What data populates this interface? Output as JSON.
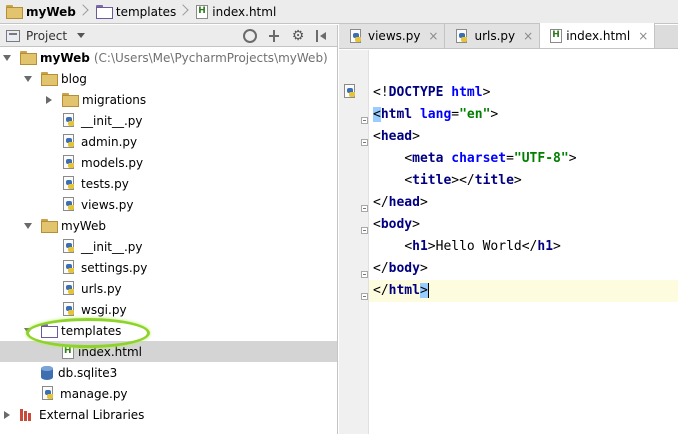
{
  "breadcrumb": {
    "items": [
      "myWeb",
      "templates",
      "index.html"
    ]
  },
  "project_panel": {
    "title": "Project",
    "tree": [
      {
        "label": "myWeb",
        "path": "(C:\\Users\\Me\\PycharmProjects\\myWeb)",
        "kind": "folder",
        "depth": 0,
        "expanded": true
      },
      {
        "label": "blog",
        "kind": "package",
        "depth": 1,
        "expanded": true
      },
      {
        "label": "migrations",
        "kind": "package",
        "depth": 2,
        "expanded": false
      },
      {
        "label": "__init__.py",
        "kind": "py",
        "depth": 2
      },
      {
        "label": "admin.py",
        "kind": "py",
        "depth": 2
      },
      {
        "label": "models.py",
        "kind": "py",
        "depth": 2
      },
      {
        "label": "tests.py",
        "kind": "py",
        "depth": 2
      },
      {
        "label": "views.py",
        "kind": "py",
        "depth": 2
      },
      {
        "label": "myWeb",
        "kind": "package",
        "depth": 1,
        "expanded": true
      },
      {
        "label": "__init__.py",
        "kind": "py",
        "depth": 2
      },
      {
        "label": "settings.py",
        "kind": "py",
        "depth": 2
      },
      {
        "label": "urls.py",
        "kind": "py",
        "depth": 2
      },
      {
        "label": "wsgi.py",
        "kind": "py",
        "depth": 2
      },
      {
        "label": "templates",
        "kind": "template-folder",
        "depth": 1,
        "expanded": true
      },
      {
        "label": "index.html",
        "kind": "html",
        "depth": 2,
        "selected": true
      },
      {
        "label": "db.sqlite3",
        "kind": "db",
        "depth": 1
      },
      {
        "label": "manage.py",
        "kind": "py",
        "depth": 1
      },
      {
        "label": "External Libraries",
        "kind": "lib",
        "depth": 0,
        "expanded": false
      }
    ]
  },
  "editor": {
    "tabs": [
      {
        "label": "views.py",
        "close": "×",
        "active": false
      },
      {
        "label": "urls.py",
        "close": "×",
        "active": false
      },
      {
        "label": "index.html",
        "close": "×",
        "active": true
      }
    ],
    "lines": [
      [
        [
          "punct",
          "<!"
        ],
        [
          "tag",
          "DOCTYPE "
        ],
        [
          "attr",
          "html"
        ],
        [
          "punct",
          ">"
        ]
      ],
      [
        [
          "match",
          "<"
        ],
        [
          "tag",
          "html "
        ],
        [
          "attr",
          "lang"
        ],
        [
          "punct",
          "="
        ],
        [
          "str",
          "\"en\""
        ],
        [
          "punct",
          ">"
        ]
      ],
      [
        [
          "punct",
          "<"
        ],
        [
          "tag",
          "head"
        ],
        [
          "punct",
          ">"
        ]
      ],
      [
        [
          "txt",
          "    "
        ],
        [
          "punct",
          "<"
        ],
        [
          "tag",
          "meta "
        ],
        [
          "attr",
          "charset"
        ],
        [
          "punct",
          "="
        ],
        [
          "str",
          "\"UTF-8\""
        ],
        [
          "punct",
          ">"
        ]
      ],
      [
        [
          "txt",
          "    "
        ],
        [
          "punct",
          "<"
        ],
        [
          "tag",
          "title"
        ],
        [
          "punct",
          "></"
        ],
        [
          "tag",
          "title"
        ],
        [
          "punct",
          ">"
        ]
      ],
      [
        [
          "punct",
          "</"
        ],
        [
          "tag",
          "head"
        ],
        [
          "punct",
          ">"
        ]
      ],
      [
        [
          "punct",
          "<"
        ],
        [
          "tag",
          "body"
        ],
        [
          "punct",
          ">"
        ]
      ],
      [
        [
          "txt",
          "    "
        ],
        [
          "punct",
          "<"
        ],
        [
          "tag",
          "h1"
        ],
        [
          "punct",
          ">"
        ],
        [
          "txt",
          "Hello World"
        ],
        [
          "punct",
          "</"
        ],
        [
          "tag",
          "h1"
        ],
        [
          "punct",
          ">"
        ]
      ],
      [
        [
          "punct",
          "</"
        ],
        [
          "tag",
          "body"
        ],
        [
          "punct",
          ">"
        ]
      ],
      [
        [
          "punct",
          "</"
        ],
        [
          "tag",
          "html"
        ],
        [
          "match",
          ">"
        ]
      ]
    ]
  },
  "colors": {
    "highlight_ring": "#8fd32a",
    "selection": "#d4d4d4",
    "current_line": "#fefcde",
    "tag": "#000080",
    "attribute": "#0000ff",
    "string": "#008000"
  }
}
